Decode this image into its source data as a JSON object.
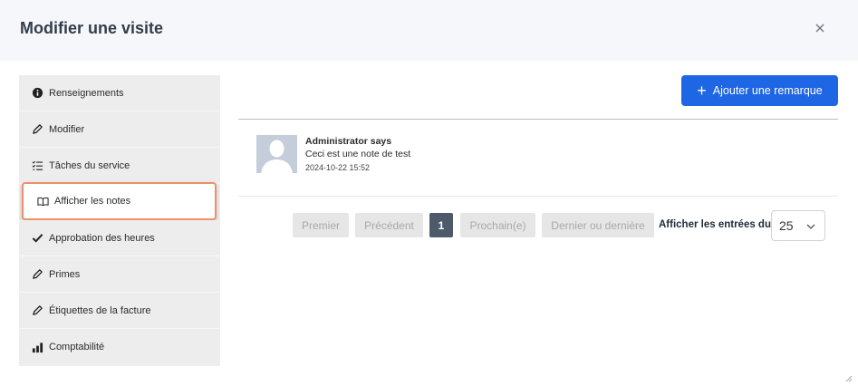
{
  "modal": {
    "title": "Modifier une visite"
  },
  "sidebar": {
    "items": [
      {
        "label": "Renseignements",
        "icon": "info-circle-icon"
      },
      {
        "label": "Modifier",
        "icon": "pencil-icon"
      },
      {
        "label": "Tâches du service",
        "icon": "checklist-icon"
      },
      {
        "label": "Afficher les notes",
        "icon": "open-book-icon",
        "active": true
      },
      {
        "label": "Approbation des heures",
        "icon": "checkmark-icon"
      },
      {
        "label": "Primes",
        "icon": "pencil-icon"
      },
      {
        "label": "Étiquettes de la facture",
        "icon": "pencil-icon"
      },
      {
        "label": "Comptabilité",
        "icon": "bar-chart-icon"
      }
    ]
  },
  "toolbar": {
    "add_label": "Ajouter une remarque"
  },
  "note": {
    "author": "Administrator says",
    "text": "Ceci est une note de test",
    "date": "2024-10-22 15:52"
  },
  "pagination": {
    "first": "Premier",
    "previous": "Précédent",
    "current_page": "1",
    "next": "Prochain(e)",
    "last": "Dernier ou dernière",
    "entries_label": "Afficher les entrées du",
    "entries_value": "25"
  },
  "colors": {
    "primary": "#1f66e5",
    "active_border": "#ef8f6b",
    "current_page": "#4c5a6a"
  }
}
